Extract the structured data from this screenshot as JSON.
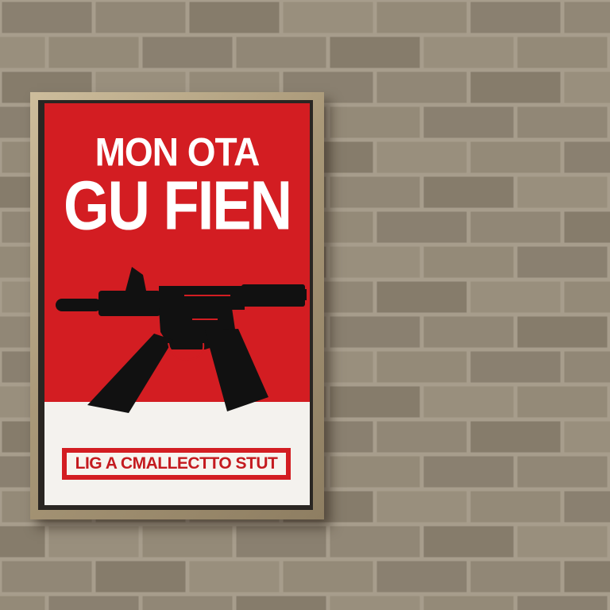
{
  "poster": {
    "headline_line1": "MON OTA",
    "headline_line2": "GU FIEN",
    "caption": "LIG A CMALLECTTO STUT",
    "graphic": "rifle-icon"
  },
  "colors": {
    "poster_red": "#d31d22",
    "poster_white": "#f4f2ee",
    "wall_brick": "#8f8574",
    "mortar": "#a79d8c",
    "frame_wood": "#b8a684",
    "gun_black": "#111111"
  }
}
